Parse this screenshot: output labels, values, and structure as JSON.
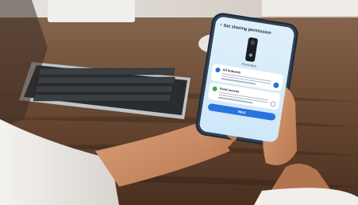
{
  "photo": {
    "description_tag": "photo-of-hands-holding-smartphone"
  },
  "phone_screen": {
    "title": "Set sharing permission",
    "back_icon": "chevron-left-icon",
    "device_label": "Front door",
    "options": [
      {
        "title": "All features",
        "icon": "shield-icon",
        "selected": true
      },
      {
        "title": "Feed access",
        "icon": "check-circle-icon",
        "selected": false
      }
    ],
    "next_label": "Next"
  },
  "colors": {
    "accent": "#2a72e0",
    "screen_bg": "#dff0fb",
    "table": "#6b4a34"
  }
}
